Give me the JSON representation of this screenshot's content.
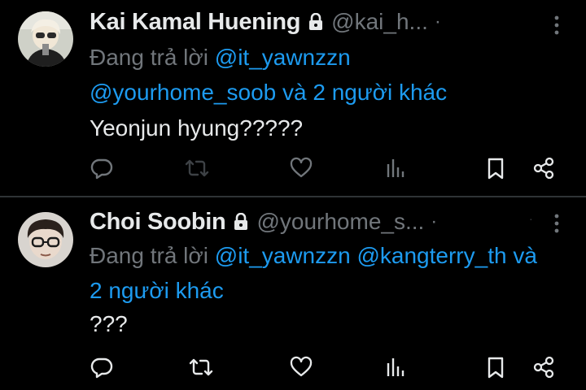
{
  "colors": {
    "background": "#000000",
    "primary_text": "#e7e9ea",
    "secondary_text": "#71767b",
    "accent": "#1d9bf0",
    "divider": "#2f3336"
  },
  "tweets": [
    {
      "display_name": "Kai Kamal Huening",
      "handle": "@kai_h...",
      "dot": "·",
      "protected_icon": "lock-icon",
      "reply_prefix": "Đang trả lời",
      "reply_mention_1": "@it_yawnzzn",
      "reply_mention_2": "@yourhome_soob",
      "reply_connector": "và",
      "reply_others": "2 người khác",
      "text": "Yeonjun hyung?????",
      "actions": [
        "reply-icon",
        "retweet-icon",
        "like-icon",
        "views-icon",
        "bookmark-icon",
        "share-icon"
      ]
    },
    {
      "display_name": "Choi Soobin",
      "handle": "@yourhome_s...",
      "dot": "·",
      "protected_icon": "lock-icon",
      "reply_prefix": "Đang trả lời",
      "reply_mention_1": "@it_yawnzzn",
      "reply_mention_2": "@kangterry_th",
      "reply_connector": "và",
      "reply_others": "2 người khác",
      "text": "???",
      "actions": [
        "reply-icon",
        "retweet-icon",
        "like-icon",
        "views-icon",
        "bookmark-icon",
        "share-icon"
      ]
    }
  ]
}
